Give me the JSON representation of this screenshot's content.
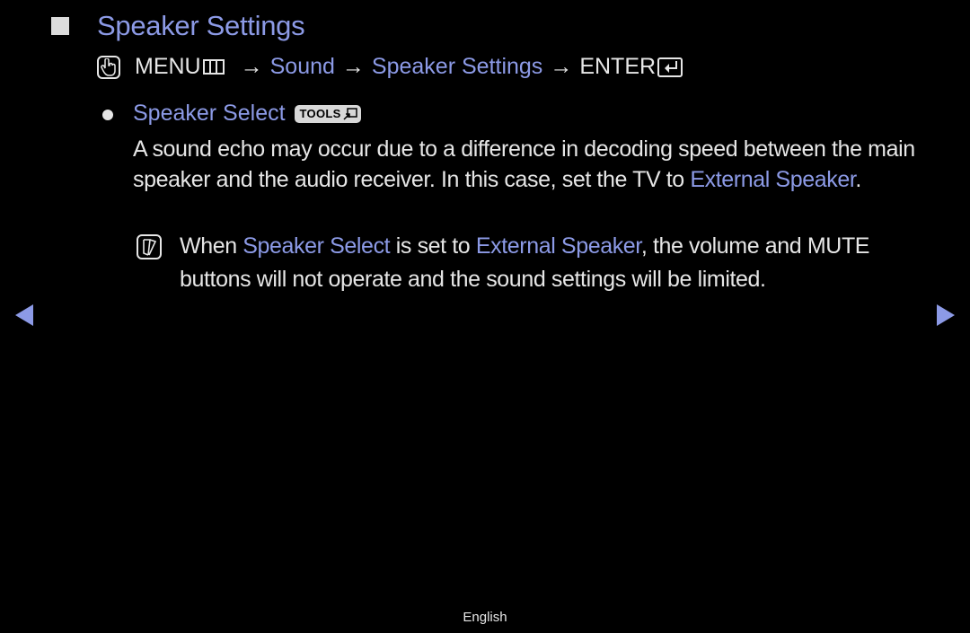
{
  "section": {
    "title": "Speaker Settings"
  },
  "path": {
    "menu_label": "MENU",
    "arrow": "→",
    "items": [
      "Sound",
      "Speaker Settings"
    ],
    "enter_label": "ENTER"
  },
  "item": {
    "title": "Speaker Select",
    "tools_badge": "TOOLS",
    "description_parts": [
      "A sound echo may occur due to a difference in decoding speed between the main speaker and the audio receiver. In this case, set the TV to ",
      "External Speaker",
      "."
    ],
    "note_parts": [
      "When ",
      "Speaker Select",
      " is set to ",
      "External Speaker",
      ", the volume and ",
      "MUTE",
      " buttons will not operate and the sound settings will be limited."
    ]
  },
  "nav": {
    "prev_icon": "triangle-left-icon",
    "next_icon": "triangle-right-icon"
  },
  "footer": {
    "language": "English"
  },
  "colors": {
    "accent": "#8c9ae6",
    "text": "#e6e6e6",
    "background": "#000000"
  }
}
